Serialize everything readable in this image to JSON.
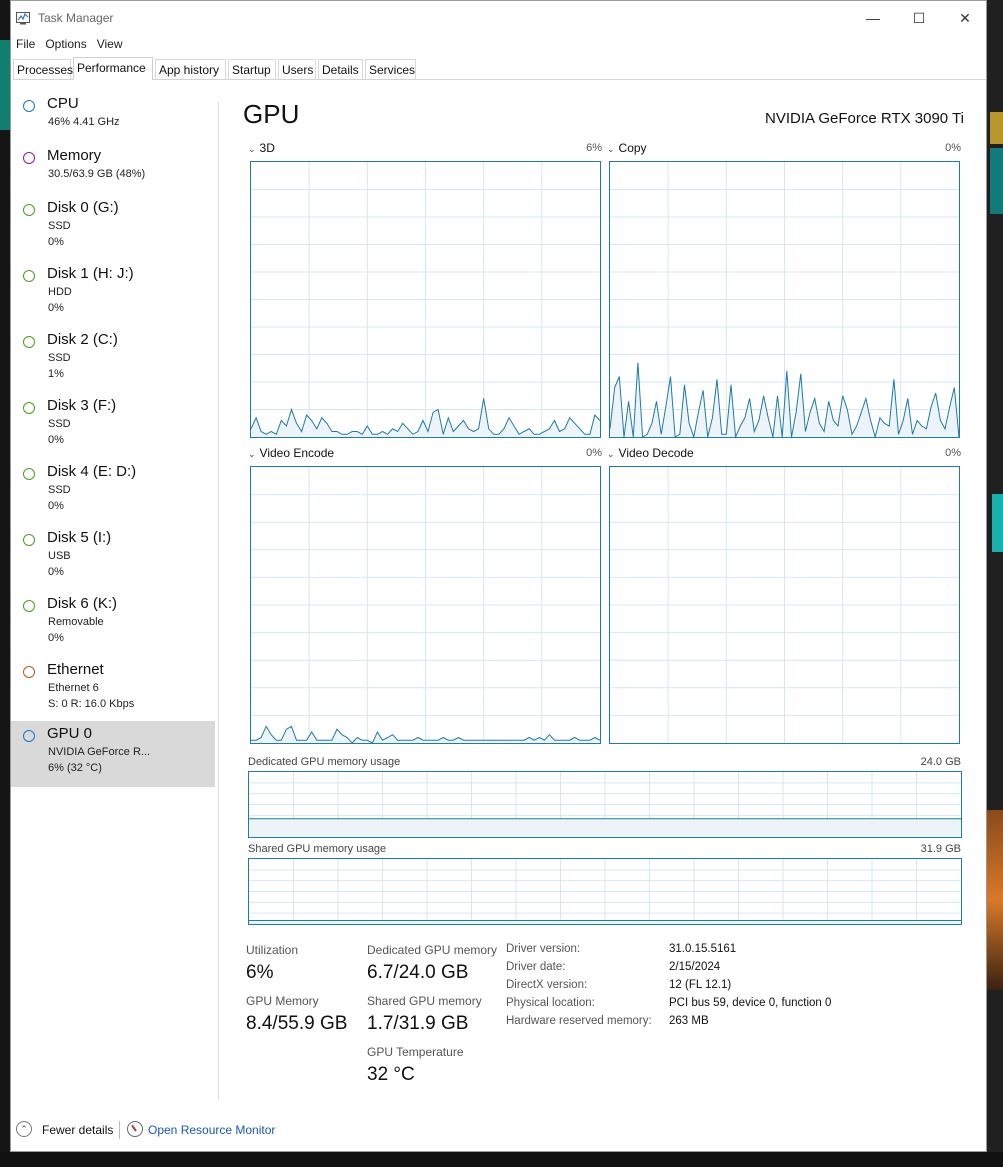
{
  "window": {
    "title": "Task Manager"
  },
  "menu": [
    "File",
    "Options",
    "View"
  ],
  "tabs": [
    "Processes",
    "Performance",
    "App history",
    "Startup",
    "Users",
    "Details",
    "Services"
  ],
  "active_tab": "Performance",
  "sidebar": [
    {
      "title": "CPU",
      "line1": "46%  4.41 GHz",
      "line2": "",
      "color": "#1b78c9"
    },
    {
      "title": "Memory",
      "line1": "30.5/63.9 GB (48%)",
      "line2": "",
      "color": "#8b1aa8"
    },
    {
      "title": "Disk 0 (G:)",
      "line1": "SSD",
      "line2": "0%",
      "color": "#4a9e1f"
    },
    {
      "title": "Disk 1 (H: J:)",
      "line1": "HDD",
      "line2": "0%",
      "color": "#4a9e1f"
    },
    {
      "title": "Disk 2 (C:)",
      "line1": "SSD",
      "line2": "1%",
      "color": "#4a9e1f"
    },
    {
      "title": "Disk 3 (F:)",
      "line1": "SSD",
      "line2": "0%",
      "color": "#4a9e1f"
    },
    {
      "title": "Disk 4 (E: D:)",
      "line1": "SSD",
      "line2": "0%",
      "color": "#4a9e1f"
    },
    {
      "title": "Disk 5 (I:)",
      "line1": "USB",
      "line2": "0%",
      "color": "#4a9e1f"
    },
    {
      "title": "Disk 6 (K:)",
      "line1": "Removable",
      "line2": "0%",
      "color": "#4a9e1f"
    },
    {
      "title": "Ethernet",
      "line1": "Ethernet 6",
      "line2": "S: 0  R: 16.0 Kbps",
      "color": "#a7601f"
    },
    {
      "title": "GPU 0",
      "line1": "NVIDIA GeForce R...",
      "line2": "6%  (32 °C)",
      "color": "#1b78c9"
    }
  ],
  "main": {
    "heading": "GPU",
    "model": "NVIDIA GeForce RTX 3090 Ti",
    "graphs": [
      {
        "label": "3D",
        "pct": "6%",
        "series": [
          3,
          7,
          2,
          1,
          2,
          1,
          6,
          4,
          10,
          5,
          2,
          8,
          6,
          3,
          7,
          5,
          2,
          2,
          1,
          1,
          2,
          2,
          1,
          4,
          1,
          1,
          2,
          1,
          3,
          2,
          5,
          3,
          1,
          2,
          6,
          2,
          9,
          10,
          1,
          7,
          2,
          4,
          6,
          3,
          2,
          3,
          14,
          3,
          1,
          1,
          3,
          7,
          4,
          1,
          2,
          3,
          1,
          1,
          2,
          3,
          6,
          2,
          3,
          7,
          5,
          3,
          1,
          1,
          8,
          6
        ]
      },
      {
        "label": "Copy",
        "pct": "0%",
        "series": [
          3,
          18,
          22,
          0,
          13,
          0,
          27,
          0,
          1,
          5,
          13,
          1,
          11,
          22,
          0,
          1,
          19,
          5,
          0,
          9,
          17,
          0,
          7,
          21,
          1,
          1,
          19,
          0,
          4,
          7,
          14,
          2,
          6,
          15,
          7,
          0,
          15,
          0,
          24,
          0,
          9,
          23,
          2,
          9,
          14,
          5,
          2,
          13,
          6,
          4,
          15,
          10,
          1,
          4,
          9,
          14,
          6,
          0,
          7,
          5,
          4,
          21,
          1,
          6,
          14,
          1,
          6,
          4,
          3,
          11,
          16,
          6,
          3,
          11,
          18,
          0
        ]
      },
      {
        "label": "Video Encode",
        "pct": "0%",
        "series": [
          1,
          1,
          2,
          6,
          3,
          1,
          1,
          5,
          6,
          1,
          1,
          1,
          4,
          1,
          1,
          1,
          1,
          5,
          3,
          2,
          0,
          2,
          1,
          1,
          0,
          4,
          1,
          2,
          3,
          1,
          1,
          1,
          1,
          2,
          1,
          1,
          1,
          1,
          2,
          1,
          1,
          2,
          1,
          1,
          1,
          1,
          1,
          1,
          1,
          1,
          1,
          1,
          1,
          1,
          1,
          2,
          1,
          2,
          1,
          3,
          1,
          1,
          1,
          1,
          2,
          1,
          1,
          1,
          2,
          1
        ]
      },
      {
        "label": "Video Decode",
        "pct": "0%",
        "series": []
      }
    ],
    "dedicated_label": "Dedicated GPU memory usage",
    "dedicated_max": "24.0 GB",
    "dedicated_fraction": 0.28,
    "shared_label": "Shared GPU memory usage",
    "shared_max": "31.9 GB",
    "shared_fraction": 0.053,
    "stats": {
      "utilization_label": "Utilization",
      "utilization": "6%",
      "gpu_memory_label": "GPU Memory",
      "gpu_memory": "8.4/55.9 GB",
      "dedicated_label": "Dedicated GPU memory",
      "dedicated": "6.7/24.0 GB",
      "shared_label": "Shared GPU memory",
      "shared": "1.7/31.9 GB",
      "temp_label": "GPU Temperature",
      "temp": "32 °C"
    },
    "info": [
      {
        "label": "Driver version:",
        "value": "31.0.15.5161"
      },
      {
        "label": "Driver date:",
        "value": "2/15/2024"
      },
      {
        "label": "DirectX version:",
        "value": "12 (FL 12.1)"
      },
      {
        "label": "Physical location:",
        "value": "PCI bus 59, device 0, function 0"
      },
      {
        "label": "Hardware reserved memory:",
        "value": "263 MB"
      }
    ]
  },
  "footer": {
    "fewer_details": "Fewer details",
    "open_resource_monitor": "Open Resource Monitor"
  },
  "colors": {
    "accent": "#1e7ba5",
    "graph_fill": "#ecf4f9",
    "grid": "#d6e7f2",
    "link": "#1a56b8"
  },
  "icons": {
    "app": "task-manager-icon",
    "minimize": "minimize-icon",
    "maximize": "maximize-icon",
    "close": "close-icon",
    "collapse": "chevron-down-icon",
    "fewer": "chevron-up-circle-icon",
    "resource_monitor": "resource-monitor-icon"
  }
}
